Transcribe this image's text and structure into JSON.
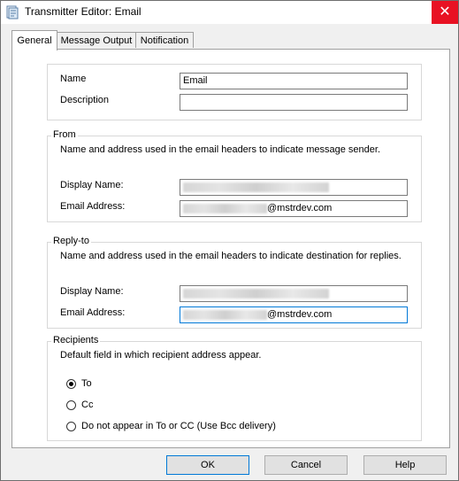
{
  "window": {
    "title": "Transmitter Editor: Email",
    "close_glyph": "✕"
  },
  "tabs": [
    {
      "label": "General",
      "active": true
    },
    {
      "label": "Message Output",
      "active": false
    },
    {
      "label": "Notification",
      "active": false
    }
  ],
  "general": {
    "name_label": "Name",
    "name_value": "Email",
    "description_label": "Description",
    "description_value": ""
  },
  "from": {
    "group_label": "From",
    "description": "Name and address used in the email headers to indicate message sender.",
    "display_name_label": "Display Name:",
    "email_address_label": "Email Address:",
    "email_address_suffix": "@mstrdev.com"
  },
  "reply_to": {
    "group_label": "Reply-to",
    "description": "Name and address used in the email headers to indicate destination for replies.",
    "display_name_label": "Display Name:",
    "email_address_label": "Email Address:",
    "email_address_suffix": "@mstrdev.com"
  },
  "recipients": {
    "group_label": "Recipients",
    "description": "Default field in which recipient address appear.",
    "options": [
      {
        "label": "To",
        "selected": true
      },
      {
        "label": "Cc",
        "selected": false
      },
      {
        "label": "Do not appear in To or CC (Use Bcc delivery)",
        "selected": false
      }
    ]
  },
  "buttons": {
    "ok": "OK",
    "cancel": "Cancel",
    "help": "Help"
  },
  "colors": {
    "accent": "#0078d7",
    "close": "#e81123"
  }
}
